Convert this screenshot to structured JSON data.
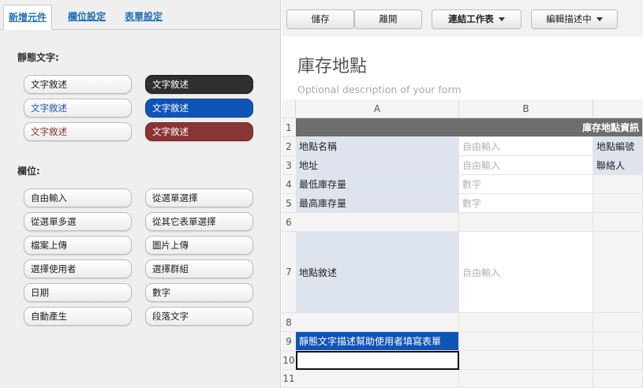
{
  "tabs": [
    {
      "label": "新增元件",
      "active": true
    },
    {
      "label": "欄位設定",
      "active": false
    },
    {
      "label": "表單設定",
      "active": false
    }
  ],
  "static_text": {
    "title": "靜態文字:",
    "items": [
      "文字敘述",
      "文字敘述",
      "文字敘述",
      "文字敘述",
      "文字敘述",
      "文字敘述"
    ]
  },
  "fields": {
    "title": "欄位:",
    "items": [
      "自由輸入",
      "從選單選擇",
      "從選單多選",
      "從其它表單選擇",
      "檔案上傳",
      "圖片上傳",
      "選擇使用者",
      "選擇群組",
      "日期",
      "數字",
      "自動產生",
      "段落文字"
    ]
  },
  "toolbar": {
    "save": "儲存",
    "leave": "離開",
    "link_sheet": "連結工作表",
    "edit_desc": "編輯描述中"
  },
  "form": {
    "title": "庫存地點",
    "description": "Optional description of your form"
  },
  "grid": {
    "columns": [
      "A",
      "B"
    ],
    "rows": [
      "1",
      "2",
      "3",
      "4",
      "5",
      "6",
      "7",
      "8",
      "9",
      "10",
      "11"
    ],
    "header_text": "庫存地點資訊",
    "labels": {
      "r2": "地點名稱",
      "r3": "地址",
      "r4": "最低庫存量",
      "r5": "最高庫存量",
      "r7": "地點敘述",
      "r2c": "地點編號",
      "r3c": "聯絡人"
    },
    "inputs": {
      "r2": "自由輸入",
      "r3": "自由輸入",
      "r4": "數字",
      "r5": "數字",
      "r7": "自由輸入"
    },
    "static_cell": "靜態文字描述幫助使用者填寫表單"
  },
  "colors": {
    "accent_blue": "#0f55b8",
    "dark": "#2f2f2f",
    "dark_red": "#8a3535",
    "header_gray": "#6e6e6e",
    "label_bg": "#dde4ee"
  }
}
